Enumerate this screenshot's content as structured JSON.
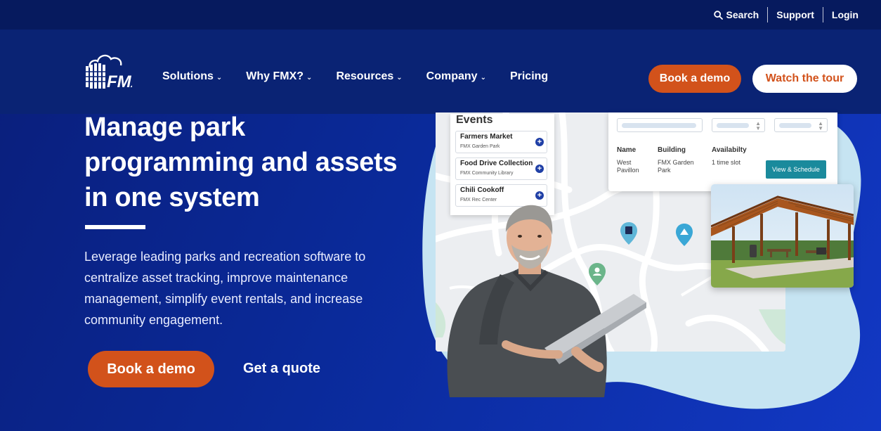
{
  "utility": {
    "search": "Search",
    "support": "Support",
    "login": "Login"
  },
  "nav": {
    "items": [
      {
        "label": "Solutions",
        "dropdown": true
      },
      {
        "label": "Why FMX?",
        "dropdown": true
      },
      {
        "label": "Resources",
        "dropdown": true
      },
      {
        "label": "Company",
        "dropdown": true
      },
      {
        "label": "Pricing",
        "dropdown": false
      }
    ],
    "book_demo": "Book a demo",
    "watch_tour": "Watch the tour"
  },
  "hero": {
    "title": "Manage park programming and assets in one system",
    "description": "Leverage leading parks and recreation software to centralize asset tracking, improve maintenance management, simplify event rentals, and increase community engagement.",
    "book_demo": "Book a demo",
    "get_quote": "Get a quote"
  },
  "graphic": {
    "events_title": "Events",
    "events": [
      {
        "name": "Farmers Market",
        "location": "FMX Garden Park"
      },
      {
        "name": "Food Drive Collection",
        "location": "FMX Community Library"
      },
      {
        "name": "Chili Cookoff",
        "location": "FMX Rec Center"
      }
    ],
    "table": {
      "headers": [
        "Name",
        "Building",
        "Availabilty"
      ],
      "row": [
        "West Pavillon",
        "FMX Garden Park",
        "1 time slot"
      ],
      "action": "View & Schedule"
    }
  },
  "colors": {
    "accent_orange": "#d2521b",
    "nav_bg": "#0a2374",
    "utility_bg": "#061a5e",
    "teal_button": "#1a8a9c"
  },
  "icons": {
    "search": "search-icon",
    "logo": "fmx-logo",
    "add": "plus-circle-icon",
    "map_pin": "map-pin-icon"
  }
}
